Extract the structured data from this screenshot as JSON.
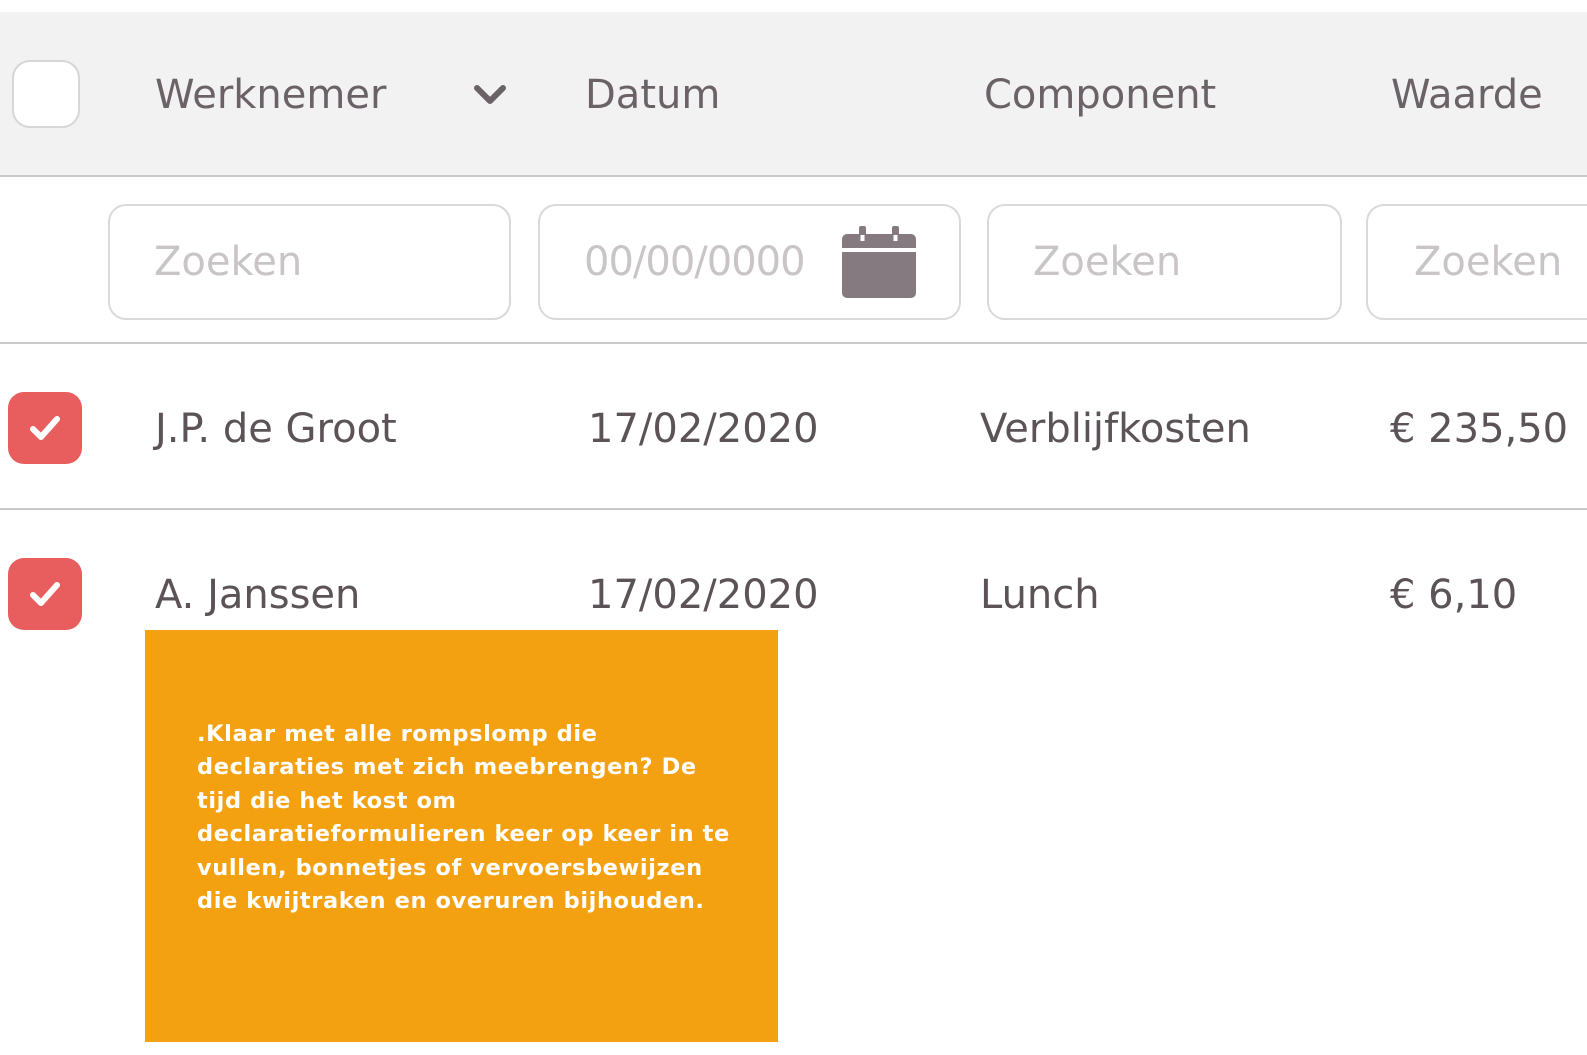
{
  "table": {
    "columns": [
      {
        "label": "Werknemer"
      },
      {
        "label": "Datum"
      },
      {
        "label": "Component"
      },
      {
        "label": "Waarde"
      }
    ],
    "sort_icon": "chevron-down-icon",
    "filters": {
      "werknemer_placeholder": "Zoeken",
      "datum_placeholder": "00/00/0000",
      "datum_icon": "calendar-icon",
      "component_placeholder": "Zoeken",
      "waarde_placeholder": "Zoeken"
    },
    "rows": [
      {
        "checked": true,
        "werknemer": "J.P. de Groot",
        "datum": "17/02/2020",
        "component": "Verblijfkosten",
        "waarde": "€ 235,50"
      },
      {
        "checked": true,
        "werknemer": "A. Janssen",
        "datum": "17/02/2020",
        "component": "Lunch",
        "waarde": "€ 6,10"
      }
    ]
  },
  "promo": {
    "text": ".Klaar met alle rompslomp die declaraties met zich meebrengen? De tijd die het kost om declaratieformulieren keer op keer in te vullen, bonnetjes of vervoersbewijzen die kwijtraken en overuren bijhouden."
  },
  "colors": {
    "checkbox_checked": "#e85e5e",
    "promo_background": "#f3a111",
    "header_background": "#f2f2f2"
  }
}
